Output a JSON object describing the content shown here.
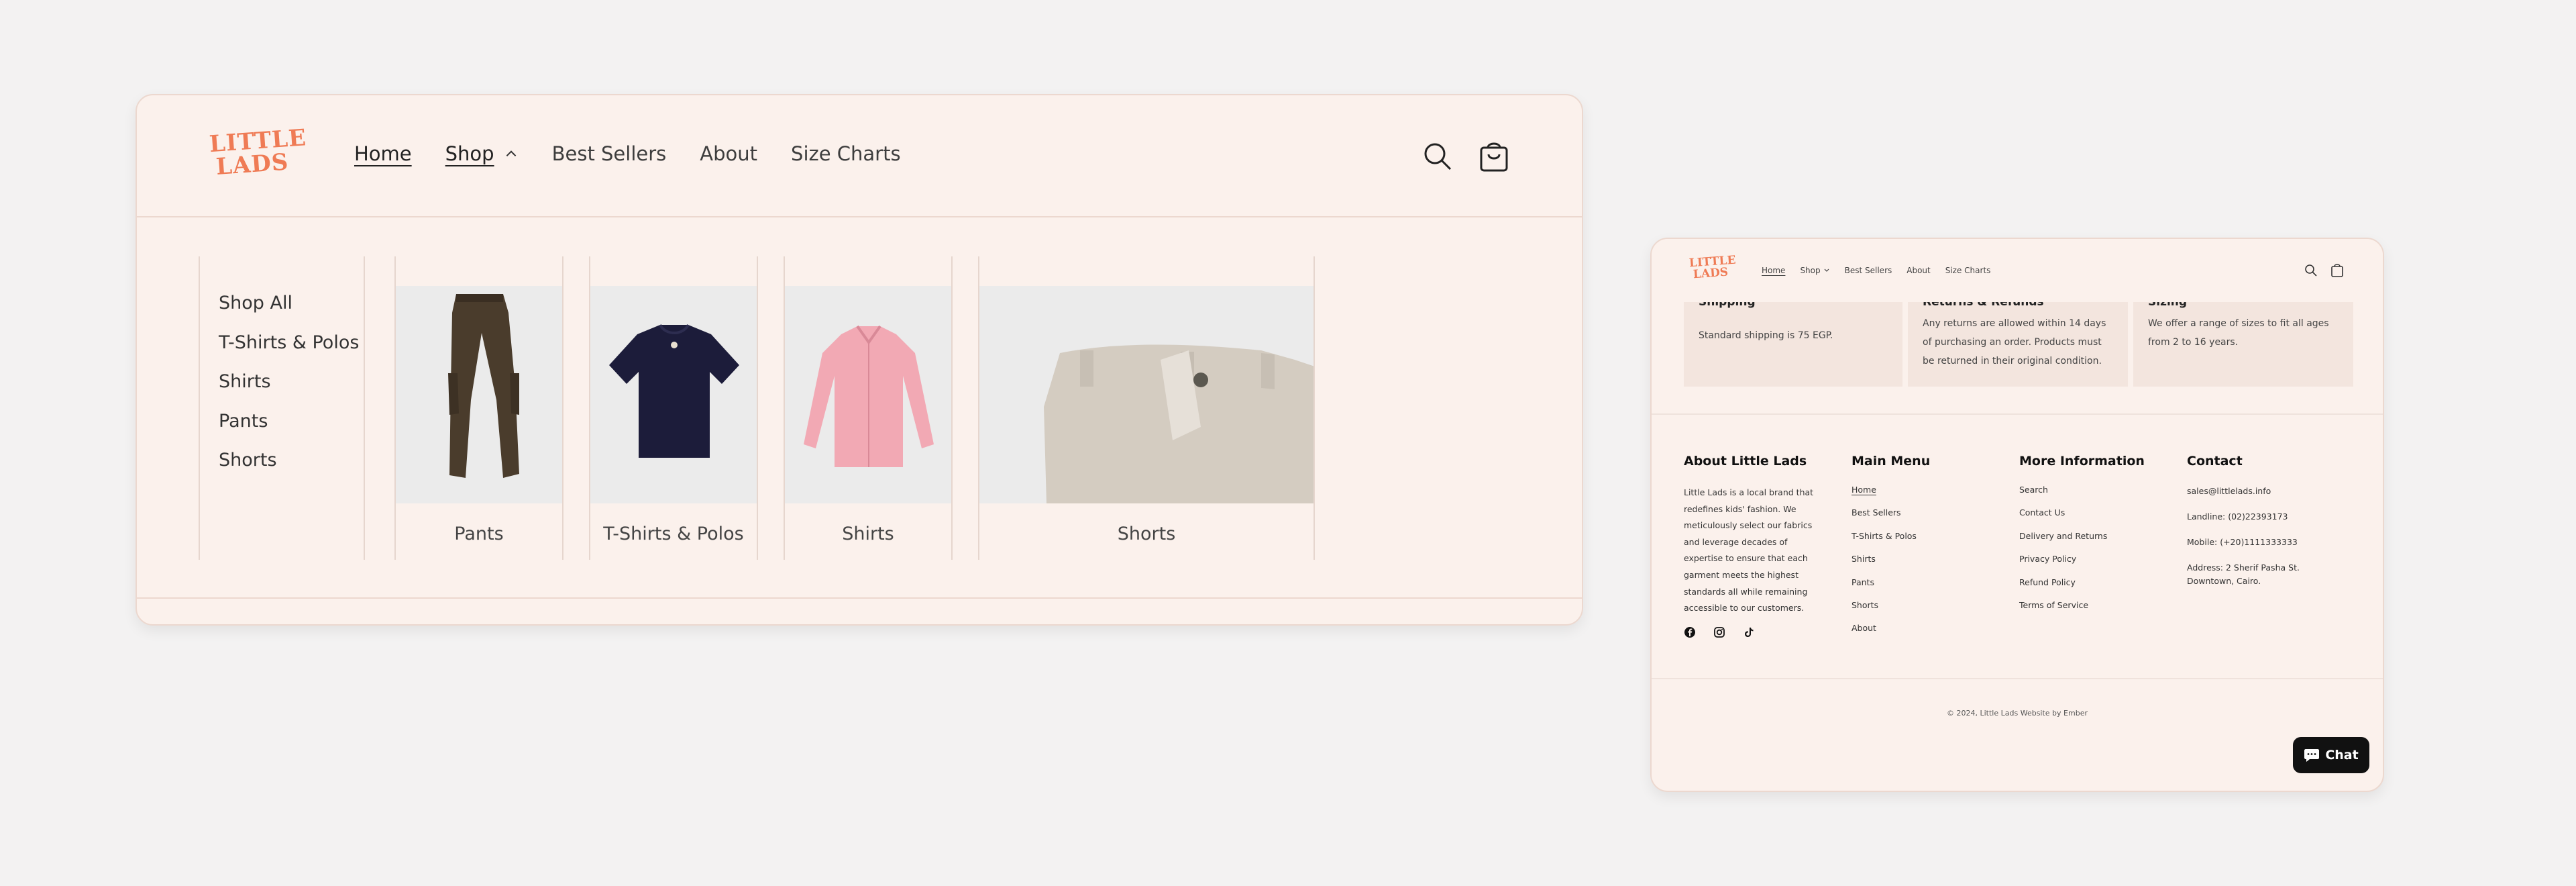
{
  "brand": {
    "logo_line1": "LITTLE",
    "logo_line2": "LADS",
    "accent": "#ef7b55"
  },
  "nav": {
    "home": "Home",
    "shop": "Shop",
    "best_sellers": "Best Sellers",
    "about": "About",
    "size_charts": "Size Charts"
  },
  "mega_menu": {
    "links": [
      "Shop All",
      "T-Shirts & Polos",
      "Shirts",
      "Pants",
      "Shorts"
    ],
    "cards": [
      {
        "label": "Pants"
      },
      {
        "label": "T-Shirts & Polos"
      },
      {
        "label": "Shirts"
      },
      {
        "label": "Shorts"
      }
    ]
  },
  "info": [
    {
      "title": "Shipping",
      "text": "Standard shipping is 75 EGP."
    },
    {
      "title": "Returns & Refunds",
      "text": "Any returns are allowed within 14 days of purchasing an order. Products must be returned in their original condition."
    },
    {
      "title": "Sizing",
      "text": "We offer a range of sizes to fit all ages from 2 to 16 years."
    }
  ],
  "footer": {
    "about_heading": "About Little Lads",
    "about_text": "Little Lads is a local brand that redefines kids' fashion. We meticulously select our fabrics and leverage decades of expertise to ensure that each garment meets the highest standards all while remaining accessible to our customers.",
    "main_menu_heading": "Main Menu",
    "main_menu": [
      "Home",
      "Best Sellers",
      "T-Shirts & Polos",
      "Shirts",
      "Pants",
      "Shorts",
      "About"
    ],
    "more_info_heading": "More Information",
    "more_info": [
      "Search",
      "Contact Us",
      "Delivery and Returns",
      "Privacy Policy",
      "Refund Policy",
      "Terms of Service"
    ],
    "contact_heading": "Contact",
    "contact": [
      "sales@littlelads.info",
      "Landline: (02)22393173",
      "Mobile: (+20)1111333333",
      "Address: 2 Sherif Pasha St. Downtown, Cairo."
    ],
    "copyright": "© 2024, Little Lads Website by Ember"
  },
  "chat": {
    "label": "Chat"
  }
}
